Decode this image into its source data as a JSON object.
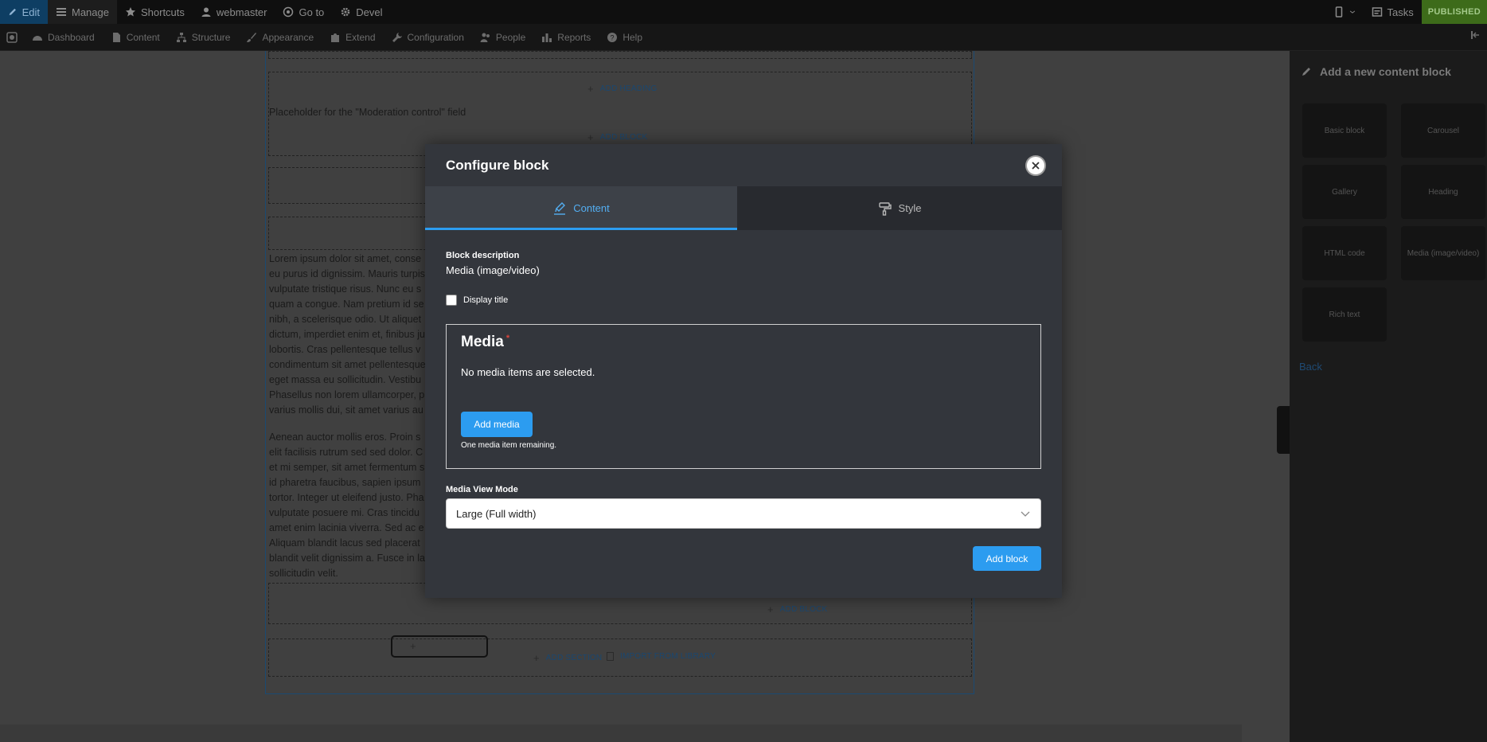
{
  "toolbar": {
    "edit": "Edit",
    "manage": "Manage",
    "shortcuts": "Shortcuts",
    "user": "webmaster",
    "goto": "Go to",
    "devel": "Devel",
    "tasks": "Tasks",
    "status": "PUBLISHED"
  },
  "menu": {
    "dashboard": "Dashboard",
    "content": "Content",
    "structure": "Structure",
    "appearance": "Appearance",
    "extend": "Extend",
    "configuration": "Configuration",
    "people": "People",
    "reports": "Reports",
    "help": "Help"
  },
  "page": {
    "add_heading": "ADD HEADING",
    "moderation_placeholder": "Placeholder for the \"Moderation control\" field",
    "add_block": "ADD BLOCK",
    "add_section": "ADD SECTION",
    "import_library": "IMPORT FROM LIBRARY",
    "paragraph1": [
      "Lorem ipsum dolor sit amet, conse",
      "eu purus id dignissim. Mauris turpis",
      "vulputate tristique risus. Nunc eu s",
      "quam a congue. Nam pretium id se",
      "nibh, a scelerisque odio. Ut aliquet",
      "dictum, imperdiet enim et, finibus ju",
      "lobortis. Cras pellentesque tellus v",
      "condimentum sit amet pellentesque",
      "eget massa eu sollicitudin. Vestibu",
      "Phasellus non lorem ullamcorper, p",
      "varius mollis dui, sit amet varius au"
    ],
    "paragraph2": [
      "Aenean auctor mollis eros. Proin s",
      "elit facilisis rutrum sed sed dolor. C",
      "et mi semper, sit amet fermentum s",
      "id pharetra faucibus, sapien ipsum",
      "tortor. Integer ut eleifend justo. Pha",
      "vulputate posuere mi. Cras tincidu",
      "amet enim lacinia viverra. Sed ac e",
      "Aliquam blandit lacus sed placerat",
      "blandit velit dignissim a. Fusce in la",
      "sollicitudin velit."
    ]
  },
  "sidebar": {
    "title": "Add a new content block",
    "cards": [
      "Basic block",
      "Carousel",
      "Gallery",
      "Heading",
      "HTML code",
      "Media (image/video)",
      "Rich text"
    ],
    "back": "Back"
  },
  "modal": {
    "title": "Configure block",
    "tabs": {
      "content": "Content",
      "style": "Style"
    },
    "block_description_label": "Block description",
    "block_description_value": "Media (image/video)",
    "display_title_label": "Display title",
    "media": {
      "title": "Media",
      "required_mark": "*",
      "empty_message": "No media items are selected.",
      "add_button": "Add media",
      "remaining": "One media item remaining."
    },
    "view_mode_label": "Media View Mode",
    "view_mode_value": "Large (Full width)",
    "submit": "Add block"
  },
  "icons": [
    "pencil-icon",
    "menu-icon",
    "star-icon",
    "user-icon",
    "compass-icon",
    "gear-icon",
    "phone-icon",
    "tasks-icon",
    "close-icon",
    "brush-icon",
    "paint-roller-icon",
    "chevron-down-icon"
  ],
  "colors": {
    "accent": "#2c9cf0",
    "modal_bg": "#33363c",
    "published": "#3d6b1a"
  }
}
